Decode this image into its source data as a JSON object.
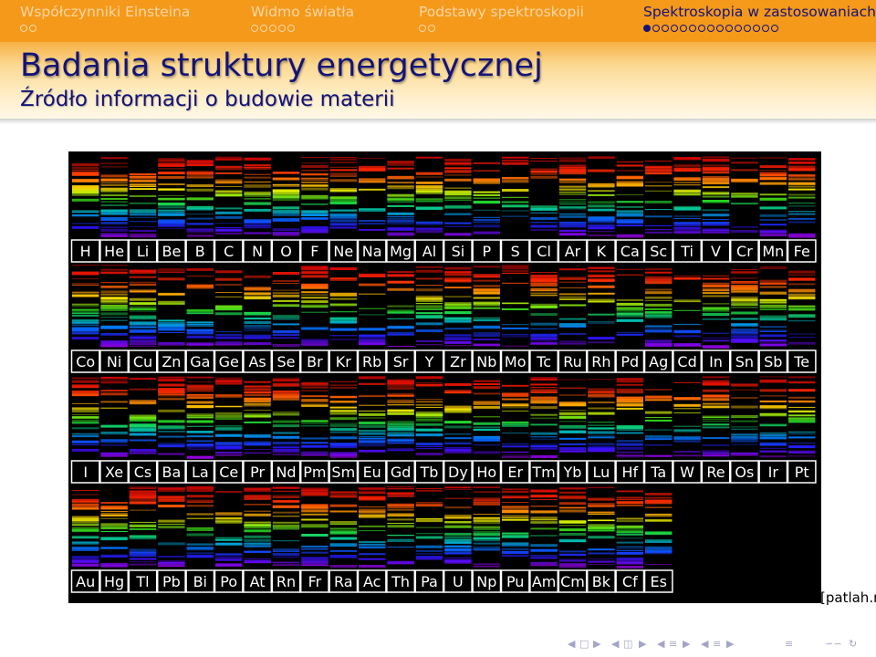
{
  "nav": {
    "sections": [
      {
        "title": "Współczynniki Einsteina",
        "dots": 2,
        "filled": 0,
        "active": false
      },
      {
        "title": "Widmo światła",
        "dots": 5,
        "filled": 0,
        "active": false
      },
      {
        "title": "Podstawy spektroskopii",
        "dots": 2,
        "filled": 0,
        "active": false
      },
      {
        "title": "Spektroskopia w zastosowaniach",
        "dots": 15,
        "filled": 1,
        "active": true
      }
    ]
  },
  "frame": {
    "title": "Badania struktury energetycznej",
    "subtitle": "Źródło informacji o budowie materii"
  },
  "spectra": {
    "rows": [
      [
        "H",
        "He",
        "Li",
        "Be",
        "B",
        "C",
        "N",
        "O",
        "F",
        "Ne",
        "Na",
        "Mg",
        "Al",
        "Si",
        "P",
        "S",
        "Cl",
        "Ar",
        "K",
        "Ca",
        "Sc",
        "Ti",
        "V",
        "Cr",
        "Mn",
        "Fe"
      ],
      [
        "Co",
        "Ni",
        "Cu",
        "Zn",
        "Ga",
        "Ge",
        "As",
        "Se",
        "Br",
        "Kr",
        "Rb",
        "Sr",
        "Y",
        "Zr",
        "Nb",
        "Mo",
        "Tc",
        "Ru",
        "Rh",
        "Pd",
        "Ag",
        "Cd",
        "In",
        "Sn",
        "Sb",
        "Te"
      ],
      [
        "I",
        "Xe",
        "Cs",
        "Ba",
        "La",
        "Ce",
        "Pr",
        "Nd",
        "Pm",
        "Sm",
        "Eu",
        "Gd",
        "Tb",
        "Dy",
        "Ho",
        "Er",
        "Tm",
        "Yb",
        "Lu",
        "Hf",
        "Ta",
        "W",
        "Re",
        "Os",
        "Ir",
        "Pt"
      ],
      [
        "Au",
        "Hg",
        "Tl",
        "Pb",
        "Bi",
        "Po",
        "At",
        "Rn",
        "Fr",
        "Ra",
        "Ac",
        "Th",
        "Pa",
        "U",
        "Np",
        "Pu",
        "Am",
        "Cm",
        "Bk",
        "Cf",
        "Es"
      ]
    ]
  },
  "credit": "[patlah.ru]",
  "colors": {
    "header_bg": "#f5991a",
    "title_color": "#13137a",
    "inactive_nav": "#fbd6a4",
    "spectra_bg": "#000000",
    "cell_border": "#ffffff"
  },
  "icons": [
    "nav-left-arrow-icon",
    "nav-frame-icon",
    "nav-right-arrow-icon",
    "nav-left-arrow-icon",
    "nav-subsection-icon",
    "nav-right-arrow-icon",
    "nav-left-arrow-icon",
    "nav-section-icon",
    "nav-right-arrow-icon",
    "nav-left-arrow-icon",
    "nav-section-icon",
    "nav-right-arrow-icon",
    "nav-align-icon",
    "nav-search-icon",
    "nav-back-icon"
  ]
}
